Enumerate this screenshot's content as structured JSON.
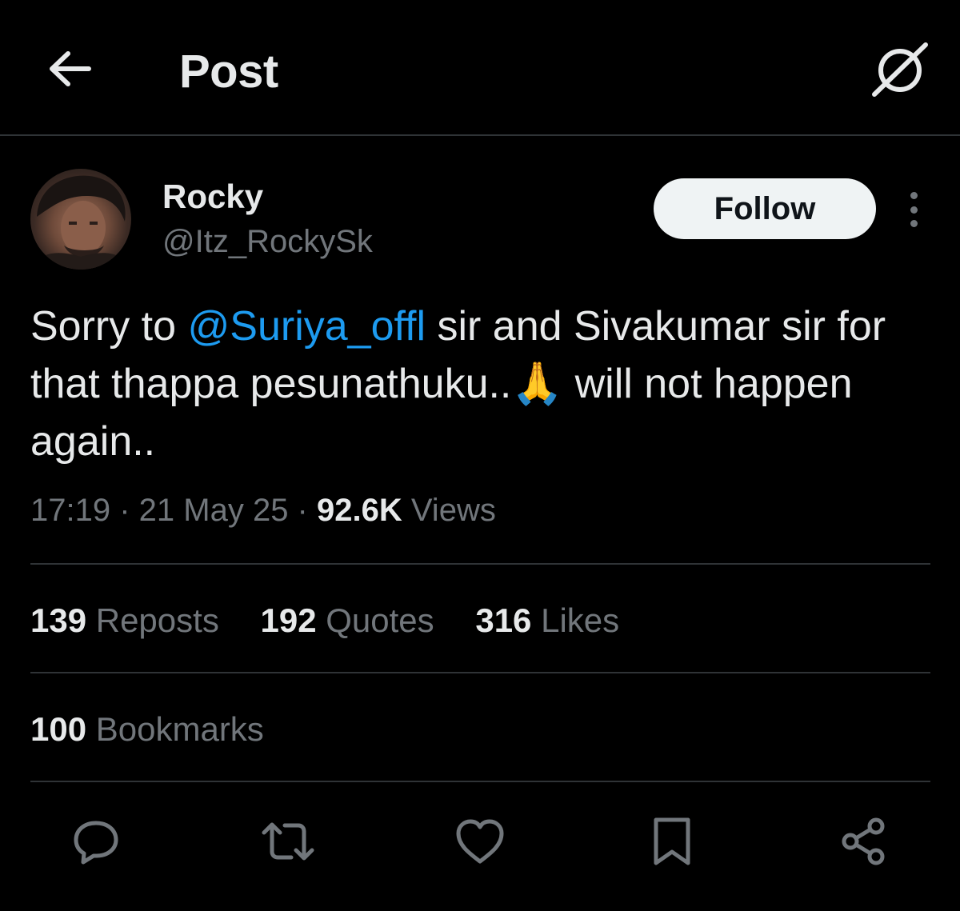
{
  "header": {
    "title": "Post",
    "back_icon": "arrow-left-icon",
    "grok_icon": "grok-icon"
  },
  "author": {
    "display_name": "Rocky",
    "handle": "@Itz_RockySk",
    "follow_label": "Follow"
  },
  "tweet": {
    "text_before": "Sorry to ",
    "mention": "@Suriya_offl",
    "text_middle": " sir and Sivakumar sir for that thappa pesunathuku..",
    "emoji": "🙏",
    "text_after": " will not happen again..",
    "time": "17:19",
    "separator": " · ",
    "date": "21 May 25",
    "views_count": "92.6K",
    "views_label": " Views"
  },
  "stats": [
    {
      "count": "139",
      "label": " Reposts"
    },
    {
      "count": "192",
      "label": " Quotes"
    },
    {
      "count": "316",
      "label": " Likes"
    }
  ],
  "bookmarks": {
    "count": "100",
    "label": " Bookmarks"
  },
  "actions": [
    "reply-icon",
    "repost-icon",
    "like-icon",
    "bookmark-icon",
    "share-icon"
  ],
  "colors": {
    "background": "#000000",
    "text_primary": "#e7e9ea",
    "text_secondary": "#71767b",
    "accent": "#1d9bf0",
    "divider": "#2f3336"
  }
}
